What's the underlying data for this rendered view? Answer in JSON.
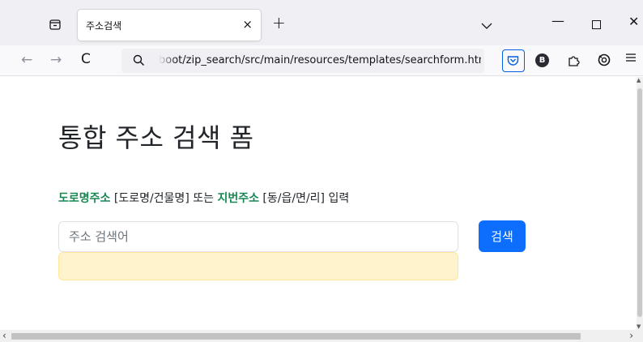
{
  "browser": {
    "tab": {
      "title": "주소검색",
      "close_glyph": "×"
    },
    "new_tab_glyph": "+",
    "window_controls": {
      "minimize": "—",
      "close": "✕"
    },
    "nav": {
      "back": "←",
      "forward": "→",
      "reload": "C"
    },
    "url": "boot/zip_search/src/main/resources/templates/searchform.html",
    "extensions": {
      "b_badge": "B"
    },
    "accent_color": "#0060df"
  },
  "page": {
    "title": "통합 주소 검색 폼",
    "instructions": {
      "road_label": "도로명주소",
      "road_detail": " [도로명/건물명] 또는 ",
      "lot_label": "지번주소",
      "lot_detail": " [동/읍/면/리] 입력"
    },
    "search": {
      "placeholder": "주소 검색어",
      "value": "",
      "button_label": "검색"
    },
    "result_box_color": "#fff3cd",
    "highlight_color": "#198754",
    "button_color": "#0d6efd"
  }
}
